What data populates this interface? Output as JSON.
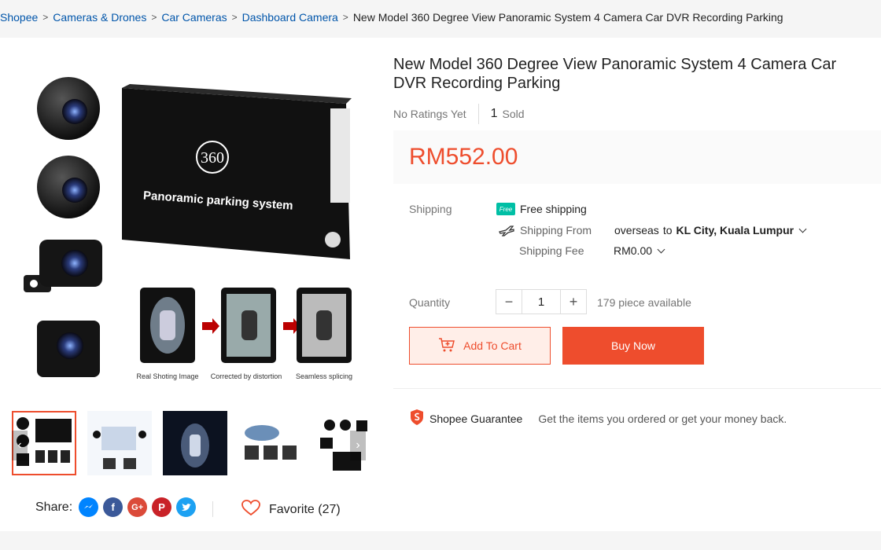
{
  "breadcrumb": {
    "items": [
      "Shopee",
      "Cameras & Drones",
      "Car Cameras",
      "Dashboard Camera"
    ],
    "current": "New Model 360 Degree View Panoramic System 4 Camera Car DVR Recording Parking"
  },
  "product": {
    "title": "New Model 360 Degree View Panoramic System 4 Camera Car DVR Recording Parking",
    "ratings_text": "No Ratings Yet",
    "sold_count": "1",
    "sold_label": "Sold",
    "price": "RM552.00"
  },
  "main_image": {
    "device_brand": "360",
    "device_label": "Panoramic parking system",
    "caption_1": "Real Shoting Image",
    "caption_2": "Corrected by distortion",
    "caption_3": "Seamless splicing"
  },
  "shipping": {
    "label": "Shipping",
    "free_badge": "Free",
    "free_text": "Free shipping",
    "from_label": "Shipping From",
    "from_value": "overseas",
    "to_word": "to",
    "to_location": "KL City, Kuala Lumpur",
    "fee_label": "Shipping Fee",
    "fee_value": "RM0.00"
  },
  "quantity": {
    "label": "Quantity",
    "minus": "−",
    "plus": "+",
    "value": "1",
    "available": "179 piece available"
  },
  "actions": {
    "add_to_cart": "Add To Cart",
    "buy_now": "Buy Now"
  },
  "guarantee": {
    "title": "Shopee Guarantee",
    "text": "Get the items you ordered or get your money back."
  },
  "share": {
    "label": "Share:",
    "networks": [
      "messenger",
      "facebook",
      "google-plus",
      "pinterest",
      "twitter"
    ]
  },
  "favorite": {
    "label": "Favorite (27)"
  },
  "colors": {
    "accent": "#ee4d2d",
    "link": "#0055aa"
  }
}
